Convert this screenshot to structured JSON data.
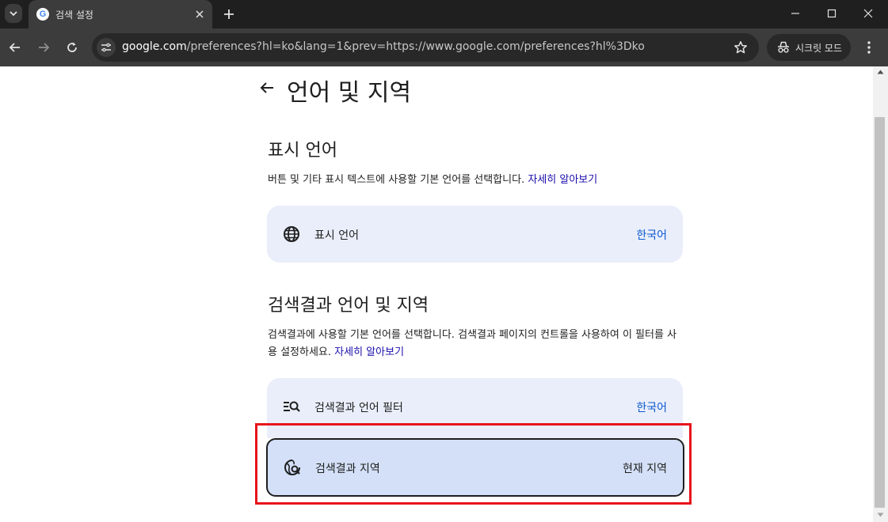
{
  "browser": {
    "tab_title": "검색 설정",
    "favicon_letter": "G",
    "url_host": "google.com",
    "url_path": "/preferences?hl=ko&lang=1&prev=https://www.google.com/preferences?hl%3Dko",
    "incognito_label": "시크릿 모드"
  },
  "page": {
    "title": "언어 및 지역",
    "display_language": {
      "heading": "표시 언어",
      "description": "버튼 및 기타 표시 텍스트에 사용할 기본 언어를 선택합니다.",
      "learn_more": "자세히 알아보기",
      "card_label": "표시 언어",
      "card_value": "한국어"
    },
    "results": {
      "heading": "검색결과 언어 및 지역",
      "description": "검색결과에 사용할 기본 언어를 선택합니다. 검색결과 페이지의 컨트롤을 사용하여 이 필터를 사용 설정하세요.",
      "learn_more": "자세히 알아보기",
      "filter_label": "검색결과 언어 필터",
      "filter_value": "한국어",
      "region_label": "검색결과 지역",
      "region_value": "현재 지역"
    }
  },
  "colors": {
    "chrome_dark": "#1f1f1f",
    "toolbar": "#3c3c3c",
    "card_bg": "#e9eefa",
    "selected_card_bg": "#d3e0f7",
    "link": "#1a0dab",
    "highlight": "#e8141b"
  },
  "icons": [
    "chevron-down-icon",
    "close-icon",
    "plus-icon",
    "minimize-icon",
    "maximize-icon",
    "back-icon",
    "forward-icon",
    "reload-icon",
    "tune-icon",
    "star-icon",
    "incognito-icon",
    "more-vert-icon",
    "arrow-back-icon",
    "globe-icon",
    "filter-search-icon",
    "globe-search-icon"
  ]
}
